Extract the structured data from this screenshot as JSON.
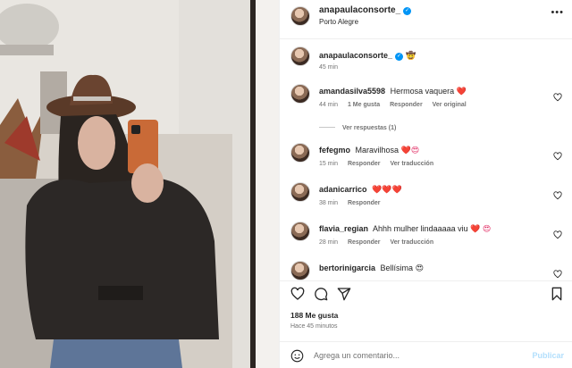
{
  "post_header": {
    "username": "anapaulaconsorte_",
    "location": "Porto Alegre",
    "more_icon": "more-horizontal-icon"
  },
  "caption": {
    "username": "anapaulaconsorte_",
    "emoji": "🤠",
    "time": "45 min"
  },
  "comments": [
    {
      "username": "amandasilva5598",
      "text": "Hermosa vaquera",
      "emoji": "❤️",
      "time": "44 min",
      "likes": "1 Me gusta",
      "reply": "Responder",
      "extra": "Ver original"
    },
    {
      "username": "fefegmo",
      "text": "Maravilhosa",
      "emoji": "❤️😍",
      "time": "15 min",
      "reply": "Responder",
      "extra": "Ver traducción"
    },
    {
      "username": "adanicarrico",
      "text": "",
      "emoji": "❤️❤️❤️",
      "time": "38 min",
      "reply": "Responder"
    },
    {
      "username": "flavia_regian",
      "text": "Ahhh mulher lindaaaaa viu",
      "emoji": "❤️ 😍",
      "time": "28 min",
      "reply": "Responder",
      "extra": "Ver traducción"
    },
    {
      "username": "bertorinigarcia",
      "text": "Bellísima",
      "emoji": "😍",
      "time": "",
      "reply": ""
    }
  ],
  "view_replies": "Ver respuestas (1)",
  "actions": {
    "like_icon": "heart-icon",
    "comment_icon": "comment-icon",
    "share_icon": "share-icon",
    "save_icon": "bookmark-icon"
  },
  "likes": "188 Me gusta",
  "posted_ago": "Hace 45 minutos",
  "comment_box": {
    "placeholder": "Agrega un comentario...",
    "publish_label": "Publicar"
  },
  "colors": {
    "verified": "#0095f6",
    "publish_disabled": "#b2dffc",
    "heart": "#e0245e"
  }
}
